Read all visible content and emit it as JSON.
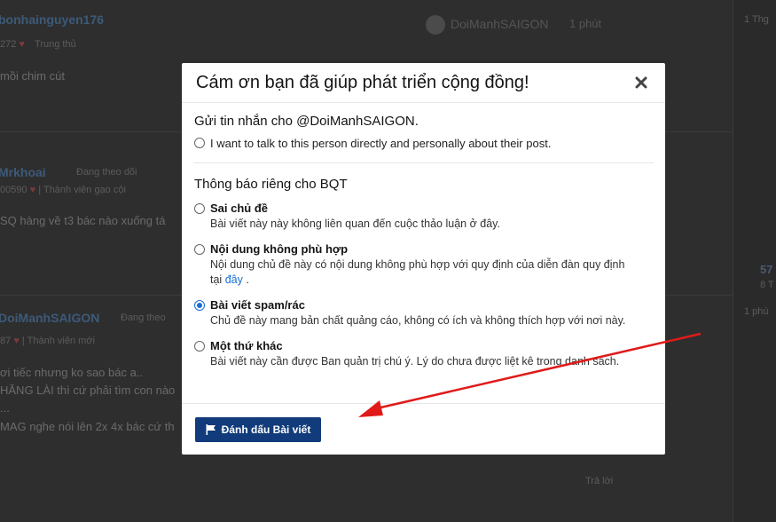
{
  "background": {
    "post1": {
      "user": "bonhainguyen176",
      "stats": "272",
      "rank": "Trung thủ",
      "body": "mồi chim cút"
    },
    "post1_meta": {
      "quoted_user": "DoiManhSAIGON",
      "time": "1 phút"
    },
    "post2": {
      "user": "Mrkhoai",
      "stats": "00590",
      "rank": "Thành viên gạo cội",
      "follow": "Đang theo dõi",
      "body": "SQ hàng về t3 bác nào xuống tá"
    },
    "post3": {
      "user": "DoiManhSAIGON",
      "stats": "87",
      "rank": "Thành viên mới",
      "follow": "Đang theo",
      "line1": "ơi tiếc nhưng ko sao bác a..",
      "line2": "HĂNG LÀI thì cứ phải tìm con nào",
      "line3": "...",
      "line4": "MAG nghe nói lên 2x 4x bác cứ th"
    },
    "right_panel": {
      "time1": "1 Thg",
      "count": "57",
      "sub": "8 T",
      "time2": "1 phú"
    },
    "bottom_reply": "Trả lời"
  },
  "modal": {
    "title": "Cám ơn bạn đã giúp phát triển cộng đồng!",
    "section1_title": "Gửi tin nhắn cho @DoiManhSAIGON.",
    "direct_option": "I want to talk to this person directly and personally about their post.",
    "section2_title": "Thông báo riêng cho BQT",
    "options": [
      {
        "label": "Sai chủ đề",
        "desc": "Bài viết này này không liên quan đến cuộc thảo luận ở đây.",
        "checked": false
      },
      {
        "label": "Nội dung không phù hợp",
        "desc": "Nội dung chủ đề này có nội dung không phù hợp với quy định của diễn đàn quy định",
        "desc2": "tại ",
        "link": "đây",
        "desc3": " .",
        "checked": false
      },
      {
        "label": "Bài viết spam/rác",
        "desc": "Chủ đề này mang bản chất quảng cáo, không có ích và không thích hợp với nơi này.",
        "checked": true
      },
      {
        "label": "Một thứ khác",
        "desc": "Bài viết này cần được Ban quản trị chú ý. Lý do chưa được liệt kê trong danh sách.",
        "checked": false
      }
    ],
    "submit_label": "Đánh dấu Bài viết"
  },
  "colors": {
    "accent": "#1a6fd1",
    "button": "#113b7a",
    "arrow": "#e01a1a"
  }
}
